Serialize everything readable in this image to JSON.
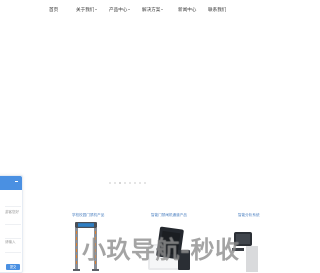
{
  "nav": {
    "items": [
      {
        "label": "首页",
        "has_caret": false
      },
      {
        "label": "关于我们",
        "has_caret": true
      },
      {
        "label": "产品中心",
        "has_caret": true
      },
      {
        "label": "解决方案",
        "has_caret": true
      },
      {
        "label": "新闻中心",
        "has_caret": false
      },
      {
        "label": "联系我们",
        "has_caret": false
      }
    ]
  },
  "carousel": {
    "dot_count": 8,
    "active_index": 2
  },
  "panel": {
    "lines": [
      "游客您好",
      "请输入",
      "提交"
    ]
  },
  "products": [
    {
      "title": "学校校园门禁机产品"
    },
    {
      "title": "智能门禁闸机通道产品"
    },
    {
      "title": "智能分析系统"
    }
  ],
  "watermark": "小玖导航-秒收",
  "colors": {
    "accent": "#4a90e2",
    "product_title": "#4a7fc0"
  }
}
